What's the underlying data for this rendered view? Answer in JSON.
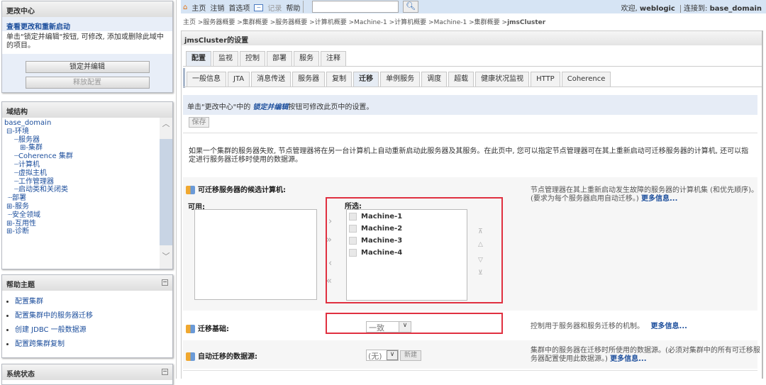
{
  "change_center": {
    "title": "更改中心",
    "view_changes": "查看更改和重新启动",
    "message": "单击\"锁定并编辑\"按钮, 可修改, 添加或删除此域中的项目。",
    "lock_button": "锁定并编辑",
    "release_button": "释放配置"
  },
  "domain_structure": {
    "title": "域结构",
    "root": "base_domain",
    "items": [
      "环境",
      "服务器",
      "集群",
      "Coherence 集群",
      "计算机",
      "虚拟主机",
      "工作管理器",
      "启动类和关闭类",
      "部署",
      "服务",
      "安全领域",
      "互用性",
      "诊断"
    ]
  },
  "help_topics": {
    "title": "帮助主题",
    "items": [
      "配置集群",
      "配置集群中的服务器迁移",
      "创建 JDBC 一般数据源",
      "配置跨集群复制"
    ]
  },
  "system_status": {
    "title": "系统状态"
  },
  "topbar": {
    "links": [
      "主页",
      "注销",
      "首选项",
      "记录",
      "帮助"
    ],
    "search_value": "",
    "welcome": "欢迎, ",
    "user": "weblogic",
    "connected_label": "连接到: ",
    "domain": "base_domain"
  },
  "breadcrumb": {
    "items": [
      "主页",
      "服务器概要",
      "集群概要",
      "服务器概要",
      "计算机概要",
      "Machine-1",
      "计算机概要",
      "Machine-1",
      "集群概要"
    ],
    "current": "jmsCluster"
  },
  "page": {
    "title": "jmsCluster的设置",
    "tabs": [
      "配置",
      "监视",
      "控制",
      "部署",
      "服务",
      "注释"
    ],
    "subtabs": [
      "一般信息",
      "JTA",
      "消息传送",
      "服务器",
      "复制",
      "迁移",
      "单例服务",
      "调度",
      "超载",
      "健康状况监视",
      "HTTP",
      "Coherence"
    ],
    "info_prefix": "单击\"更改中心\"中的 ",
    "info_link": "锁定并编辑",
    "info_suffix": "按钮可修改此页中的设置。",
    "save": "保存",
    "description": "如果一个集群的服务器失败, 节点管理器将在另一台计算机上自动重新启动此服务器及其服务。在此页中, 您可以指定节点管理器可在其上重新启动可迁移服务器的计算机, 还可以指定进行服务器迁移时使用的数据源。",
    "candidates": {
      "label": "可迁移服务器的候选计算机:",
      "available": "可用:",
      "chosen": "所选:",
      "chosen_items": [
        "Machine-1",
        "Machine-2",
        "Machine-3",
        "Machine-4"
      ],
      "help": "节点管理器在其上重新启动发生故障的服务器的计算机集 (和优先顺序)。(要求为每个服务器启用自动迁移。)",
      "more": "更多信息..."
    },
    "basis": {
      "label": "迁移基础:",
      "value": "一致",
      "help": "控制用于服务器和服务迁移的机制。",
      "more": "更多信息..."
    },
    "datasource": {
      "label": "自动迁移的数据源:",
      "value": "(无)",
      "new": "新建",
      "help": "集群中的服务器在迁移时所使用的数据源。(必须对集群中的所有可迁移服务器配置使用此数据源。)",
      "more": "更多信息..."
    }
  }
}
